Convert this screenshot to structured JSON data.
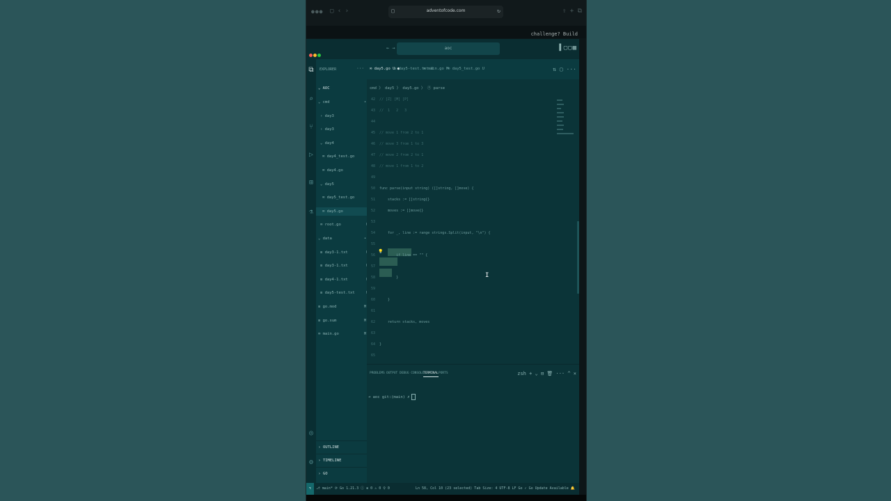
{
  "browser": {
    "url": "adventofcode.com",
    "lock_icon": "lock-icon",
    "reload_icon": "reload-icon",
    "top_right_text": "challenge? Build"
  },
  "window": {
    "command_center": "aoc",
    "nav_arrows": "← →"
  },
  "sidebar": {
    "title": "EXPLORER",
    "more": "···",
    "root": "AOC",
    "tree": [
      {
        "label": "cmd",
        "badge": "•",
        "indent": 1,
        "open": true
      },
      {
        "label": "day3",
        "badge": "",
        "indent": 2,
        "open": false
      },
      {
        "label": "day3",
        "badge": "",
        "indent": 2,
        "open": false
      },
      {
        "label": "day4",
        "badge": "",
        "indent": 2,
        "open": true
      },
      {
        "label": "day4_test.go",
        "badge": "U",
        "indent": 3
      },
      {
        "label": "day4.go",
        "badge": "U",
        "indent": 3
      },
      {
        "label": "day5",
        "badge": "",
        "indent": 2,
        "open": true
      },
      {
        "label": "day5_test.go",
        "badge": "U",
        "indent": 3
      },
      {
        "label": "day5.go",
        "badge": "U",
        "indent": 3,
        "selected": true
      },
      {
        "label": "root.go",
        "badge": "U",
        "indent": 2
      },
      {
        "label": "data",
        "badge": "•",
        "indent": 1,
        "open": true
      },
      {
        "label": "day3-1.txt",
        "badge": "U",
        "indent": 2
      },
      {
        "label": "day3-1.txt",
        "badge": "U",
        "indent": 2
      },
      {
        "label": "day4-1.txt",
        "badge": "U",
        "indent": 2
      },
      {
        "label": "day5-test.txt",
        "badge": "U",
        "indent": 2
      },
      {
        "label": "go.mod",
        "badge": "M",
        "indent": 1
      },
      {
        "label": "go.sum",
        "badge": "M",
        "indent": 1
      },
      {
        "label": "main.go",
        "badge": "M",
        "indent": 1
      }
    ],
    "bottom": [
      "OUTLINE",
      "TIMELINE",
      "GO"
    ]
  },
  "tabs": [
    {
      "label": "day5.go U",
      "active": true
    },
    {
      "label": "day5-test.txt U",
      "active": false
    },
    {
      "label": "main.go M",
      "active": false
    },
    {
      "label": "day5_test.go U",
      "active": false
    }
  ],
  "breadcrumb": "cmd 〉 day5 〉 day5.go 〉 ⓕ parse",
  "code_lines": [
    {
      "n": "42",
      "text": "// [Z] [M] [P]",
      "comment": true
    },
    {
      "n": "43",
      "text": "//  1   2   3",
      "comment": true
    },
    {
      "n": "44",
      "text": ""
    },
    {
      "n": "45",
      "text": "// move 1 from 2 to 1",
      "comment": true
    },
    {
      "n": "46",
      "text": "// move 3 from 1 to 3",
      "comment": true
    },
    {
      "n": "47",
      "text": "// move 2 from 2 to 1",
      "comment": true
    },
    {
      "n": "48",
      "text": "// move 1 from 1 to 2",
      "comment": true
    },
    {
      "n": "49",
      "text": ""
    },
    {
      "n": "50",
      "text": "func parse(input string) ([]string, []move) {"
    },
    {
      "n": "51",
      "text": "    stacks := []string{}"
    },
    {
      "n": "52",
      "text": "    moves := []move{}"
    },
    {
      "n": "53",
      "text": ""
    },
    {
      "n": "54",
      "text": "    for _, line := range strings.Split(input, \"\\n\") {"
    },
    {
      "n": "55",
      "text": ""
    },
    {
      "n": "56",
      "text": "        if line == \"\" {"
    },
    {
      "n": "57",
      "text": "            "
    },
    {
      "n": "58",
      "text": "        }"
    },
    {
      "n": "59",
      "text": ""
    },
    {
      "n": "60",
      "text": "    }"
    },
    {
      "n": "61",
      "text": ""
    },
    {
      "n": "62",
      "text": "    return stacks, moves"
    },
    {
      "n": "63",
      "text": ""
    },
    {
      "n": "64",
      "text": "}"
    },
    {
      "n": "65",
      "text": ""
    }
  ],
  "panel": {
    "tabs": [
      "PROBLEMS",
      "OUTPUT",
      "DEBUG CONSOLE",
      "TERMINAL",
      "PORTS"
    ],
    "active_tab": "TERMINAL",
    "icons": "zsh + ⌄ ⊟ 🗑 ··· ^ ×",
    "prompt": "➜  aoc git:(main) ✗"
  },
  "statusbar": {
    "remote": "⌥",
    "left": "⎇ main* ⟳   Go 1.21.3 ⓘ   ⊗ 0 ⚠ 0   ⚲ 0",
    "right": "Ln 58, Col 10 (23 selected)   Tab Size: 4   UTF-8   LF   Go   ✓ Go Update Available   🔔"
  },
  "colors": {
    "background": "#2b5559",
    "editor": "#0b3438",
    "sidebar": "#0b3b40",
    "selection": "#2b5d53",
    "close": "#ff5f57",
    "minimize": "#febc2e",
    "maximize": "#28c840"
  }
}
